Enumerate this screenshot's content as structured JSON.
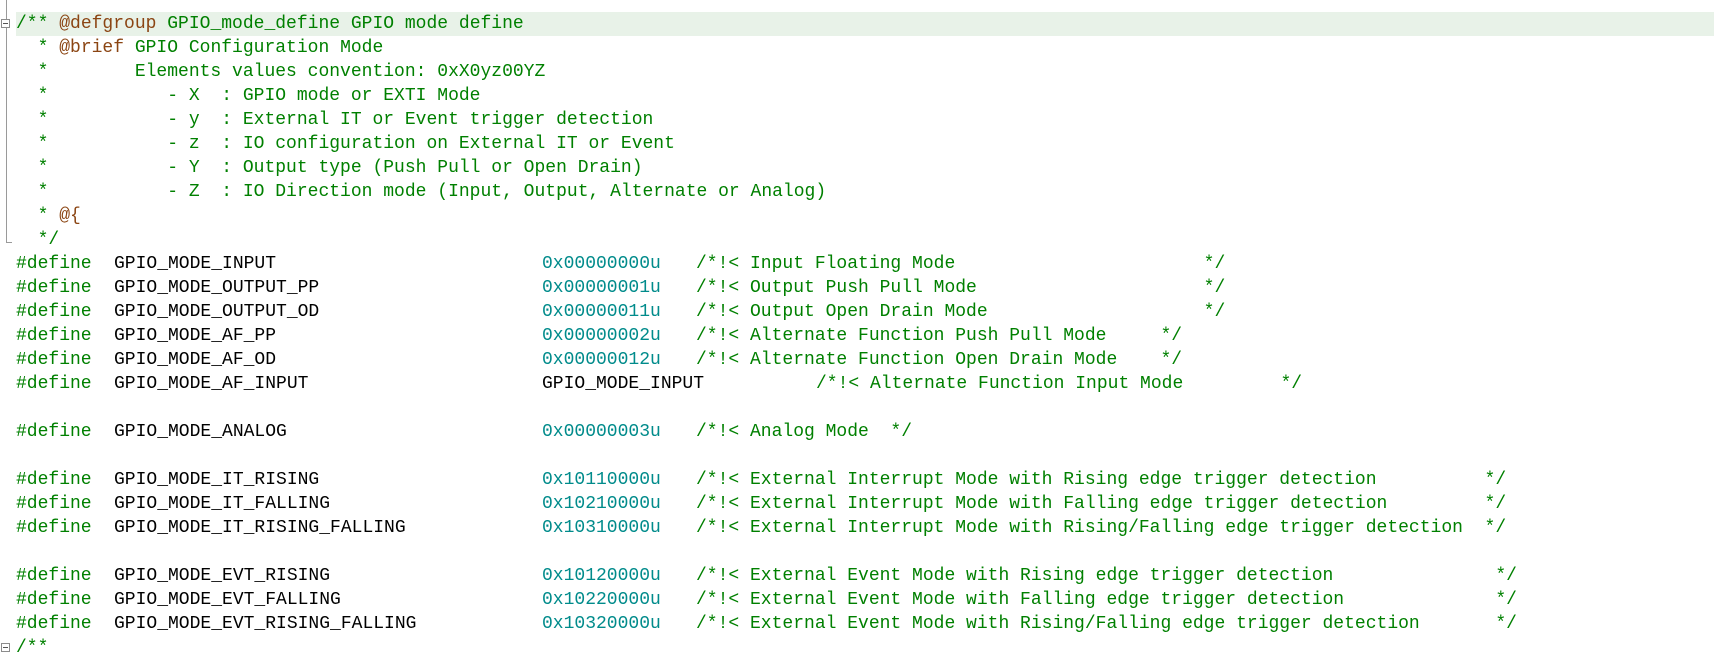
{
  "doc_block": [
    {
      "type": "doc",
      "text": "/** ",
      "tag": "@defgroup",
      "rest": " GPIO_mode_define GPIO mode define"
    },
    {
      "type": "doc",
      "text": "  * ",
      "tag": "@brief",
      "rest": " GPIO Configuration Mode"
    },
    {
      "type": "plain",
      "text": "  *        Elements values convention: 0xX0yz00YZ"
    },
    {
      "type": "plain",
      "text": "  *           - X  : GPIO mode or EXTI Mode"
    },
    {
      "type": "plain",
      "text": "  *           - y  : External IT or Event trigger detection"
    },
    {
      "type": "plain",
      "text": "  *           - z  : IO configuration on External IT or Event"
    },
    {
      "type": "plain",
      "text": "  *           - Y  : Output type (Push Pull or Open Drain)"
    },
    {
      "type": "plain",
      "text": "  *           - Z  : IO Direction mode (Input, Output, Alternate or Analog)"
    },
    {
      "type": "doc",
      "text": "  * ",
      "tag": "@{",
      "rest": ""
    },
    {
      "type": "plain",
      "text": "  */"
    }
  ],
  "defines": [
    {
      "kw": "#define",
      "name": "GPIO_MODE_INPUT",
      "value": "0x00000000u",
      "value_is_num": true,
      "comment": "/*!< Input Floating Mode                       */",
      "wide": false
    },
    {
      "kw": "#define",
      "name": "GPIO_MODE_OUTPUT_PP",
      "value": "0x00000001u",
      "value_is_num": true,
      "comment": "/*!< Output Push Pull Mode                     */",
      "wide": false
    },
    {
      "kw": "#define",
      "name": "GPIO_MODE_OUTPUT_OD",
      "value": "0x00000011u",
      "value_is_num": true,
      "comment": "/*!< Output Open Drain Mode                    */",
      "wide": false
    },
    {
      "kw": "#define",
      "name": "GPIO_MODE_AF_PP",
      "value": "0x00000002u",
      "value_is_num": true,
      "comment": "/*!< Alternate Function Push Pull Mode     */",
      "wide": false
    },
    {
      "kw": "#define",
      "name": "GPIO_MODE_AF_OD",
      "value": "0x00000012u",
      "value_is_num": true,
      "comment": "/*!< Alternate Function Open Drain Mode    */",
      "wide": false
    },
    {
      "kw": "#define",
      "name": "GPIO_MODE_AF_INPUT",
      "value": "GPIO_MODE_INPUT",
      "value_is_num": false,
      "comment": "/*!< Alternate Function Input Mode         */",
      "wide": true
    },
    null,
    {
      "kw": "#define",
      "name": "GPIO_MODE_ANALOG",
      "value": "0x00000003u",
      "value_is_num": true,
      "comment": "/*!< Analog Mode  */",
      "wide": false
    },
    null,
    {
      "kw": "#define",
      "name": "GPIO_MODE_IT_RISING",
      "value": "0x10110000u",
      "value_is_num": true,
      "comment": "/*!< External Interrupt Mode with Rising edge trigger detection          */",
      "wide": false
    },
    {
      "kw": "#define",
      "name": "GPIO_MODE_IT_FALLING",
      "value": "0x10210000u",
      "value_is_num": true,
      "comment": "/*!< External Interrupt Mode with Falling edge trigger detection         */",
      "wide": false
    },
    {
      "kw": "#define",
      "name": "GPIO_MODE_IT_RISING_FALLING",
      "value": "0x10310000u",
      "value_is_num": true,
      "comment": "/*!< External Interrupt Mode with Rising/Falling edge trigger detection  */",
      "wide": false
    },
    null,
    {
      "kw": "#define",
      "name": "GPIO_MODE_EVT_RISING",
      "value": "0x10120000u",
      "value_is_num": true,
      "comment": "/*!< External Event Mode with Rising edge trigger detection               */",
      "wide": false
    },
    {
      "kw": "#define",
      "name": "GPIO_MODE_EVT_FALLING",
      "value": "0x10220000u",
      "value_is_num": true,
      "comment": "/*!< External Event Mode with Falling edge trigger detection              */",
      "wide": false
    },
    {
      "kw": "#define",
      "name": "GPIO_MODE_EVT_RISING_FALLING",
      "value": "0x10320000u",
      "value_is_num": true,
      "comment": "/*!< External Event Mode with Rising/Falling edge trigger detection       */",
      "wide": false
    }
  ],
  "trailing_line": "/**",
  "colors": {
    "comment": "#008000",
    "doc_tag": "#8b4513",
    "number": "#008b8b",
    "identifier": "#000000",
    "current_line_bg": "#e8f2e8"
  },
  "gutter_icons": [
    "fold-collapse-icon",
    "fold-end-icon"
  ]
}
